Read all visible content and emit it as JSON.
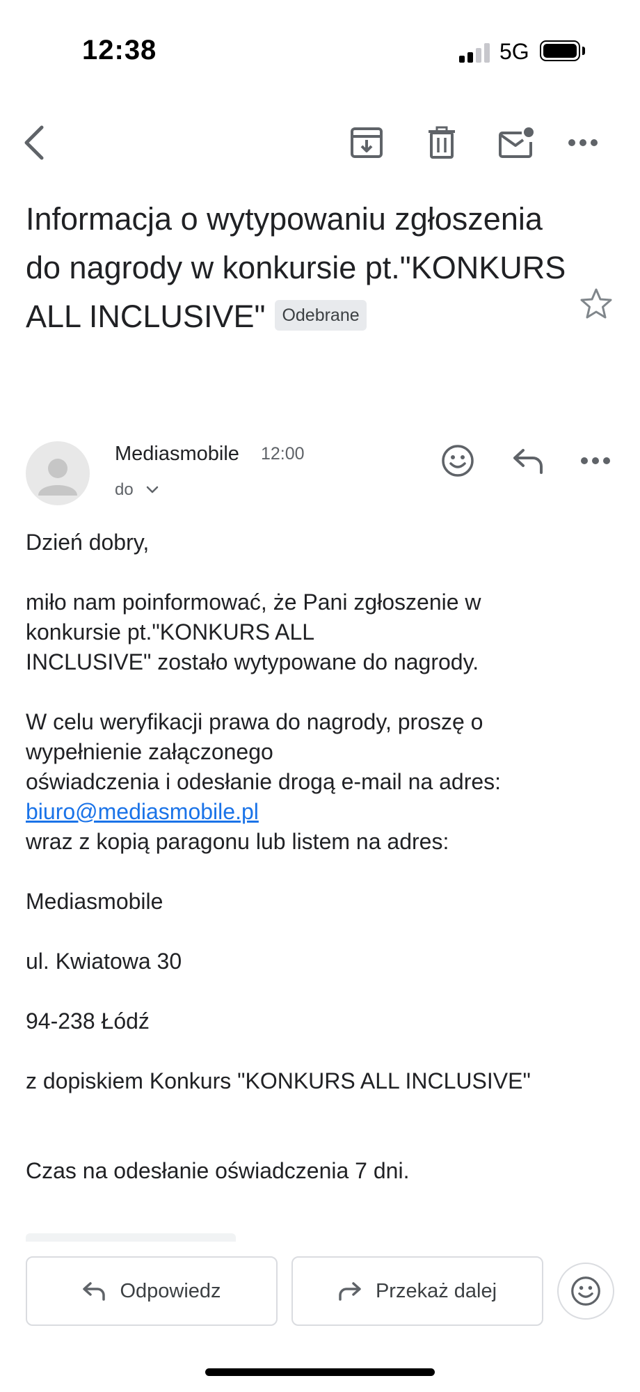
{
  "status_bar": {
    "time": "12:38",
    "network": "5G",
    "icons": [
      "signal-icon",
      "battery-icon"
    ]
  },
  "toolbar": {
    "icons": [
      "back-icon",
      "archive-icon",
      "delete-icon",
      "mark-unread-icon",
      "more-icon"
    ]
  },
  "email": {
    "subject": "Informacja o wytypowaniu zgłoszenia do nagrody w konkursie pt.\"KONKURS ALL INCLUSIVE\"",
    "label": "Odebrane",
    "starred": false,
    "sender": {
      "name": "Mediasmobile",
      "time": "12:00",
      "recipient_label": "do"
    },
    "body": {
      "greeting": "Dzień dobry,",
      "para1_line1": "miło nam poinformować, że Pani zgłoszenie w",
      "para1_line2": "konkursie pt.\"KONKURS ALL",
      "para1_line3": "INCLUSIVE\" zostało wytypowane do nagrody.",
      "para2_line1": "W celu weryfikacji prawa do nagrody, proszę o",
      "para2_line2": "wypełnienie załączonego",
      "para2_line3": "oświadczenia i odesłanie drogą e-mail na adres:",
      "email_link": "biuro@mediasmobile.pl",
      "para2_line5": "wraz z kopią paragonu lub listem na adres:",
      "address_name": "Mediasmobile",
      "address_street": "ul. Kwiatowa 30",
      "address_city": "94-238 Łódź",
      "note": "z dopiskiem Konkurs \"KONKURS ALL INCLUSIVE\"",
      "deadline": "Czas na odesłanie oświadczenia 7 dni."
    }
  },
  "actions": {
    "reply": "Odpowiedz",
    "forward": "Przekaż dalej"
  },
  "colors": {
    "link": "#1a73e8",
    "text": "#202124",
    "secondary": "#5f6368",
    "border": "#dadce0"
  }
}
